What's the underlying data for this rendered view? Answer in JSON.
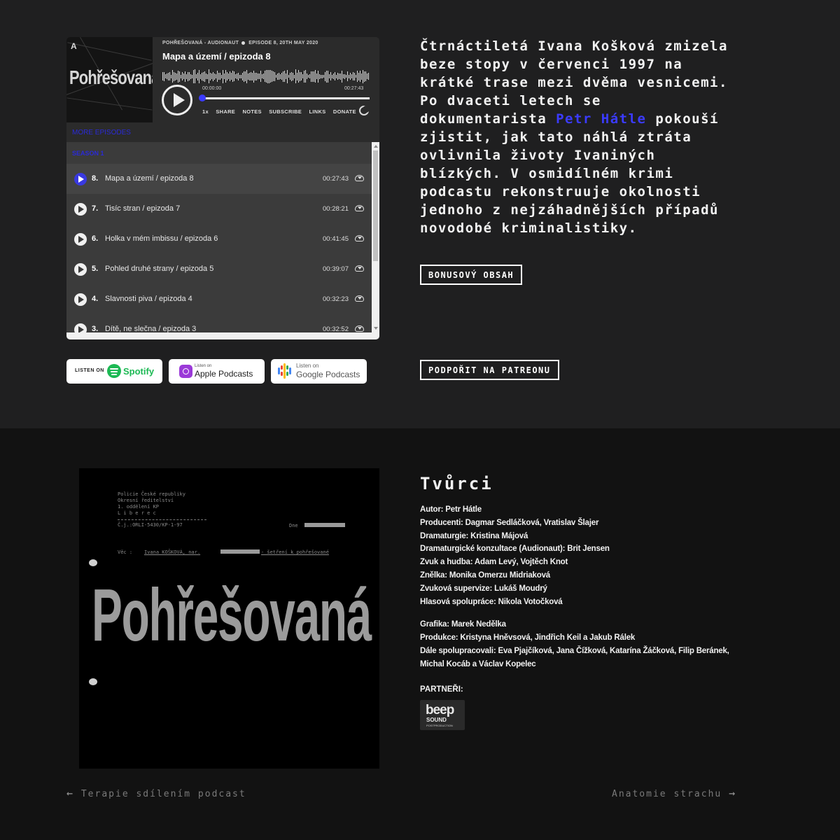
{
  "player": {
    "cover": {
      "title": "Pohřešovaná",
      "logo": "A"
    },
    "meta_show": "POHŘEŠOVANÁ - AUDIONAUT",
    "meta_episode": "EPISODE 8, 20TH MAY 2020",
    "episode_title": "Mapa a území / epizoda 8",
    "time_current": "00:00:00",
    "time_duration": "00:27:43",
    "progress": 0,
    "controls": [
      "1x",
      "SHARE",
      "NOTES",
      "SUBSCRIBE",
      "LINKS",
      "DONATE"
    ],
    "more_episodes": "MORE EPISODES",
    "season": "SEASON 1",
    "episodes": [
      {
        "num": "8.",
        "title": "Mapa a území / epizoda 8",
        "duration": "00:27:43",
        "active": true
      },
      {
        "num": "7.",
        "title": "Tisíc stran / epizoda 7",
        "duration": "00:28:21",
        "active": false
      },
      {
        "num": "6.",
        "title": "Holka v mém imbissu / epizoda 6",
        "duration": "00:41:45",
        "active": false
      },
      {
        "num": "5.",
        "title": "Pohled druhé strany / epizoda 5",
        "duration": "00:39:07",
        "active": false
      },
      {
        "num": "4.",
        "title": "Slavnosti piva / epizoda 4",
        "duration": "00:32:23",
        "active": false
      },
      {
        "num": "3.",
        "title": "Dítě, ne slečna / epizoda 3",
        "duration": "00:32:52",
        "active": false
      }
    ]
  },
  "badges": {
    "spotify_small": "LISTEN ON",
    "spotify_big": "Spotify",
    "apple_small": "Listen on",
    "apple_big": "Apple Podcasts",
    "google_small": "Listen on",
    "google_big": "Google Podcasts"
  },
  "description": {
    "text_before": "Čtrnáctiletá Ivana Košková zmizela beze stopy v červenci 1997 na krátké trase mezi dvěma vesnicemi. Po dvaceti letech se dokumentarista ",
    "link": "Petr Hátle",
    "text_after": " pokouší zjistit, jak tato náhlá ztráta ovlivnila životy Ivaniných blízkých. V osmidílném krimi podcastu rekonstruuje okolnosti jednoho z nejzáhadnějších případů novodobé kriminalistiky.",
    "link_color": "#3b3bff"
  },
  "buttons": {
    "bonus": "BONUSOVÝ OBSAH",
    "patreon": "PODPOŘIT NA PATREONU"
  },
  "artwork": {
    "doc_header": "Policie České republiky\nOkresní ředitelství\n1. oddělení KP\nL i b e r e c",
    "doc_ref": "Č.j.:ORLI-5430/KP-1-97",
    "doc_date_label": "Dne",
    "doc_subject_label": "Věc :",
    "doc_subject_text": "Ivana KOŠKOVÁ, nar.",
    "doc_subject_tail": "- šetření k pohřešované",
    "title": "Pohřešovaná"
  },
  "credits": {
    "heading": "Tvůrci",
    "lines_group1": [
      "Autor: Petr Hátle",
      "Producenti: Dagmar Sedláčková, Vratislav Šlajer",
      "Dramaturgie: Kristina Májová",
      "Dramaturgické konzultace (Audionaut): Brit Jensen",
      "Zvuk a hudba: Adam Levý, Vojtěch Knot",
      "Znělka: Monika Omerzu Midriaková",
      "Zvuková supervize: Lukáš Moudrý",
      "Hlasová spolupráce: Nikola Votočková"
    ],
    "lines_group2": [
      "Grafika: Marek Nedělka",
      "Produkce: Kristyna Hněvsová, Jindřich Keil a Jakub Rálek",
      "Dále spolupracovali: Eva Pjajčíková, Jana Čížková, Katarína Žáčková, Filip Beránek, Michal Kocáb a Václav Kopelec"
    ],
    "partners_label": "PARTNEŘI:",
    "partner_logo": {
      "line1": "beep",
      "line2": "SOUND",
      "line3": "POSTPRODUCTION"
    }
  },
  "nav": {
    "prev": "Terapie sdílením podcast",
    "next": "Anatomie strachu"
  }
}
